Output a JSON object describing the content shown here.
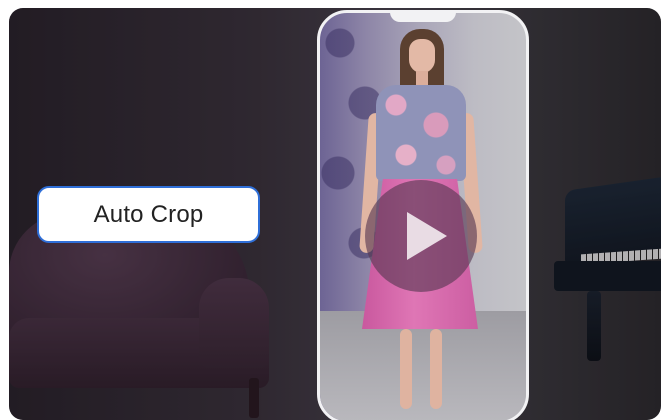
{
  "feature_label": "Auto Crop",
  "play_button": {
    "icon": "play-icon"
  },
  "colors": {
    "pill_border": "#2f6fd8",
    "phone_frame": "#f2f2f4",
    "play_bg": "#553750"
  }
}
